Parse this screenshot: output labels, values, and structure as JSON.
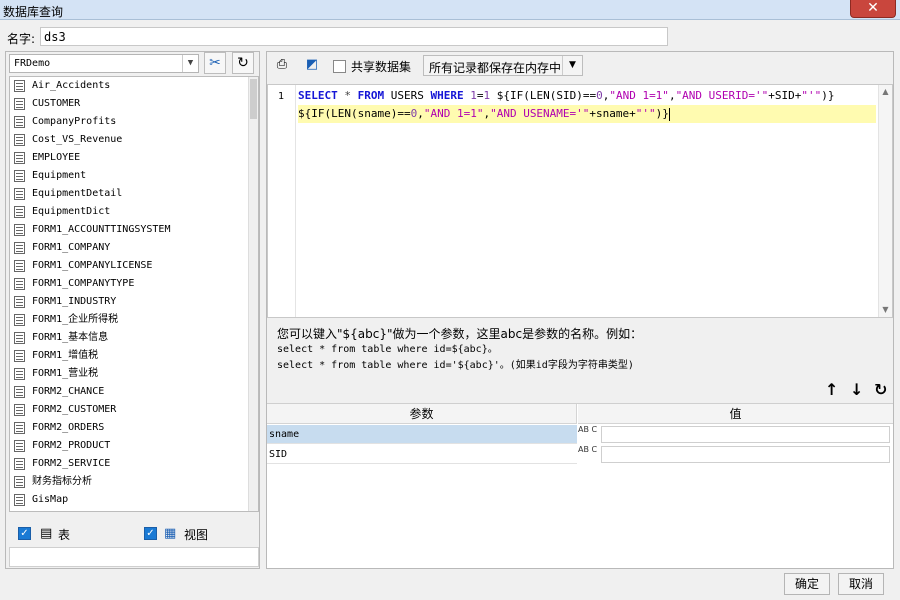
{
  "window": {
    "title": "数据库查询",
    "close_label": "✕"
  },
  "name_field": {
    "label": "名字:",
    "value": "ds3"
  },
  "connection": {
    "selected": "FRDemo"
  },
  "tables": [
    "Air_Accidents",
    "CUSTOMER",
    "CompanyProfits",
    "Cost_VS_Revenue",
    "EMPLOYEE",
    "Equipment",
    "EquipmentDetail",
    "EquipmentDict",
    "FORM1_ACCOUNTTINGSYSTEM",
    "FORM1_COMPANY",
    "FORM1_COMPANYLICENSE",
    "FORM1_COMPANYTYPE",
    "FORM1_INDUSTRY",
    "FORM1_企业所得税",
    "FORM1_基本信息",
    "FORM1_增值税",
    "FORM1_营业税",
    "FORM2_CHANCE",
    "FORM2_CUSTOMER",
    "FORM2_ORDERS",
    "FORM2_PRODUCT",
    "FORM2_SERVICE",
    "财务指标分析",
    "GisMap"
  ],
  "filters": {
    "table_label": "表",
    "view_label": "视图"
  },
  "toolbar": {
    "share_label": "共享数据集",
    "memory_option": "所有记录都保存在内存中"
  },
  "editor": {
    "line_number": "1"
  },
  "hint": {
    "line1": "您可以键入\"${abc}\"做为一个参数，这里abc是参数的名称。例如：",
    "line2": "select * from table where id=${abc}。",
    "line3": "select * from table where id='${abc}'。(如果id字段为字符串类型)"
  },
  "params": {
    "header_name": "参数",
    "header_value": "值",
    "rows": [
      {
        "name": "sname",
        "type": "AB C",
        "value": ""
      },
      {
        "name": "SID",
        "type": "AB C",
        "value": ""
      }
    ]
  },
  "buttons": {
    "ok": "确定",
    "cancel": "取消"
  }
}
